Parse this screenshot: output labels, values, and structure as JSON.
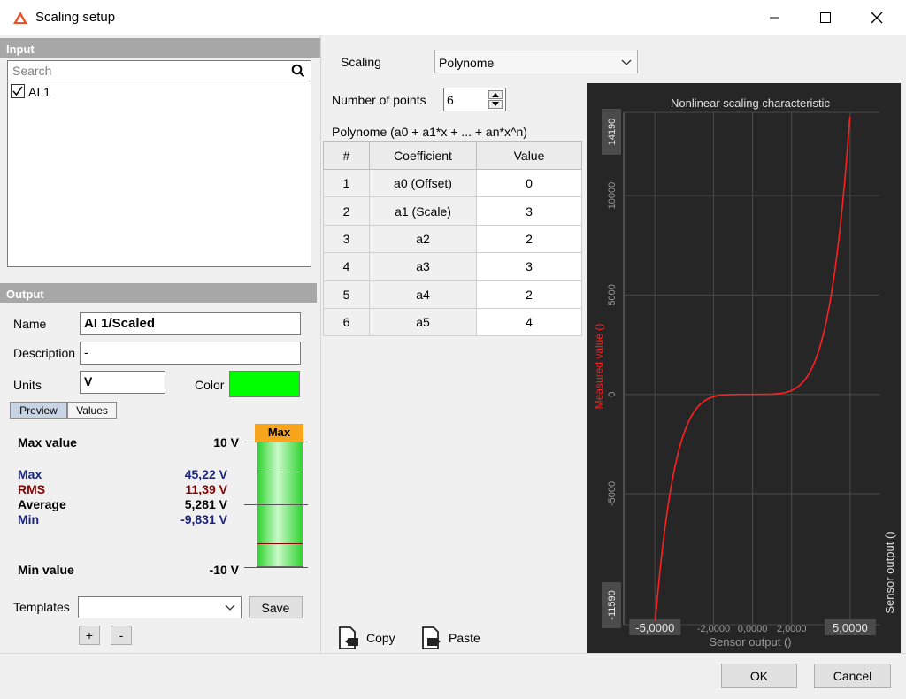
{
  "window": {
    "title": "Scaling setup"
  },
  "input": {
    "header": "Input",
    "search_placeholder": "Search",
    "channels": [
      {
        "label": "AI 1",
        "checked": true
      }
    ]
  },
  "output": {
    "header": "Output",
    "name_label": "Name",
    "name_value": "AI 1/Scaled",
    "description_label": "Description",
    "description_value": "-",
    "units_label": "Units",
    "units_value": "V",
    "color_label": "Color",
    "color_value": "#00ff00",
    "tabs": {
      "preview": "Preview",
      "values": "Values"
    },
    "stats": {
      "max_value_label": "Max value",
      "max_value": "10 V",
      "max_label": "Max",
      "max": "45,22 V",
      "rms_label": "RMS",
      "rms": "11,39 V",
      "average_label": "Average",
      "average": "5,281 V",
      "min_label": "Min",
      "min": "-9,831 V",
      "min_value_label": "Min value",
      "min_value": "-10 V"
    },
    "bar_tag": "Max",
    "templates_label": "Templates",
    "templates_value": "",
    "save_label": "Save",
    "plus_label": "+",
    "minus_label": "-"
  },
  "scaling": {
    "label": "Scaling",
    "selected": "Polynome",
    "points_label": "Number of points",
    "points_value": "6",
    "formula": "Polynome (a0 + a1*x + ... + an*x^n)",
    "table": {
      "headers": [
        "#",
        "Coefficient",
        "Value"
      ],
      "rows": [
        [
          "1",
          "a0 (Offset)",
          "0"
        ],
        [
          "2",
          "a1 (Scale)",
          "3"
        ],
        [
          "3",
          "a2",
          "2"
        ],
        [
          "4",
          "a3",
          "3"
        ],
        [
          "5",
          "a4",
          "2"
        ],
        [
          "6",
          "a5",
          "4"
        ]
      ]
    },
    "copy_label": "Copy",
    "paste_label": "Paste"
  },
  "chart_data": {
    "type": "line",
    "title": "Nonlinear scaling characteristic",
    "xlabel": "Sensor output ()",
    "ylabel": "Measured value ()",
    "y2label": "Sensor output ()",
    "xlim": [
      -6.6,
      6.5
    ],
    "ylim": [
      -11590,
      14190
    ],
    "x_tick_labels": [
      "-5,0000",
      "-2,0000",
      "0,0000",
      "2,0000",
      "5,0000"
    ],
    "y_tick_labels": [
      "14190",
      "10000",
      "5000",
      "0",
      "-5000",
      "-11590"
    ],
    "grid": true,
    "series": [
      {
        "color": "#ff2020",
        "coefficients": [
          0,
          3,
          2,
          3,
          2,
          4
        ]
      }
    ]
  },
  "footer": {
    "ok_label": "OK",
    "cancel_label": "Cancel"
  }
}
